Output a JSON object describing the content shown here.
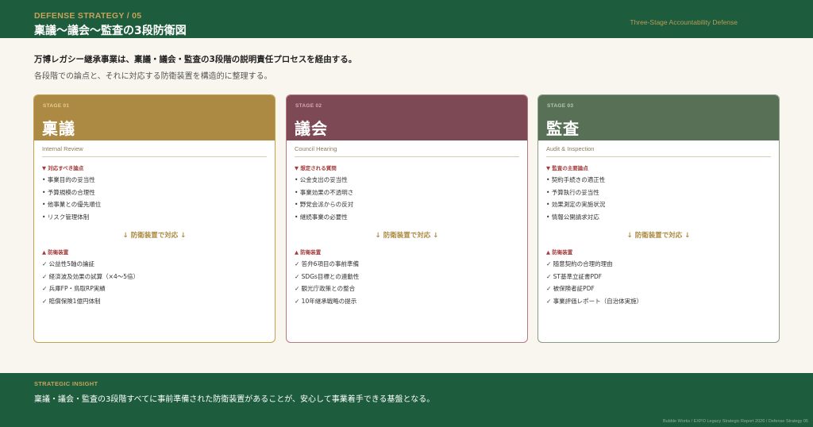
{
  "header": {
    "kicker": "DEFENSE STRATEGY / 05",
    "title": "稟議〜議会〜監査の3段防衛図",
    "right": "Three-Stage Accountability Defense"
  },
  "lead": {
    "line1": "万博レガシー継承事業は、稟議・議会・監査の3段階の説明責任プロセスを経由する。",
    "line2": "各段階での論点と、それに対応する防衛装置を構造的に整理する。"
  },
  "colors": {
    "header_bg": "#1d5c3d",
    "accent_gold": "#c6a35a",
    "stage1": "#ad8a43",
    "stage2": "#7d4954",
    "stage3": "#587156",
    "issue_red": "#a33a3a"
  },
  "stages": [
    {
      "no": "STAGE 01",
      "name": "稟議",
      "sub": "Internal Review",
      "issues_head": "▼ 対応すべき論点",
      "issues": [
        "• 事業目的の妥当性",
        "• 予算規模の合理性",
        "• 他事業との優先順位",
        "• リスク管理体制"
      ],
      "arrow": "↓ 防衛装置で対応 ↓",
      "defense_head": "▲ 防衛装置",
      "defenses": [
        "✓ 公益性5軸の論証",
        "✓ 経済波及効果の試算（×4〜5倍）",
        "✓ 兵庫FP・鳥取RP実績",
        "✓ 賠償保険1億円体制"
      ]
    },
    {
      "no": "STAGE 02",
      "name": "議会",
      "sub": "Council Hearing",
      "issues_head": "▼ 想定される質問",
      "issues": [
        "• 公金支出の妥当性",
        "• 事業効果の不透明さ",
        "• 野党会派からの反対",
        "• 継続事業の必要性"
      ],
      "arrow": "↓ 防衛装置で対応 ↓",
      "defense_head": "▲ 防衛装置",
      "defenses": [
        "✓ 答弁6項目の事前準備",
        "✓ SDGs目標との連動性",
        "✓ 観光庁政策との整合",
        "✓ 10年継承戦略の提示"
      ]
    },
    {
      "no": "STAGE 03",
      "name": "監査",
      "sub": "Audit & Inspection",
      "issues_head": "▼ 監査の主要論点",
      "issues": [
        "• 契約手続きの適正性",
        "• 予算執行の妥当性",
        "• 効果測定の実施状況",
        "• 情報公開請求対応"
      ],
      "arrow": "↓ 防衛装置で対応 ↓",
      "defense_head": "▲ 防衛装置",
      "defenses": [
        "✓ 随意契約の合理的理由",
        "✓ ST基準立証書PDF",
        "✓ 被保険者証PDF",
        "✓ 事業評価レポート（自治体実施）"
      ]
    }
  ],
  "insight": {
    "label": "STRATEGIC INSIGHT",
    "text": "稟議・議会・監査の3段階すべてに事前準備された防衛装置があることが、安心して事業着手できる基盤となる。",
    "footer": "Bubble Works  /  EXPO Legacy Strategic Report 2026  /  Defense Strategy 05"
  }
}
